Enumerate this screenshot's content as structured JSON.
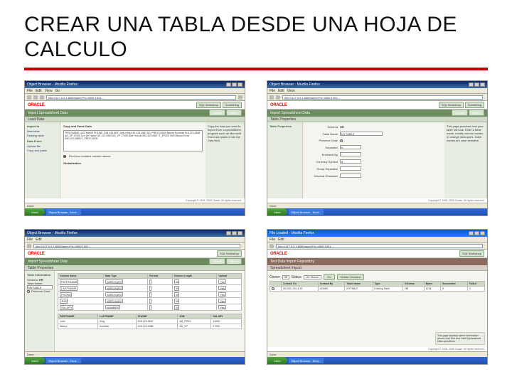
{
  "slide": {
    "title": "CREAR UNA TABLA DESDE UNA HOJA DE CALCULO"
  },
  "common": {
    "window_title": "Object Browser - Mozilla Firefox",
    "menu": {
      "file": "File",
      "edit": "Edit",
      "view": "View",
      "go": "Go"
    },
    "url": "http://127.0.0.1:8080/apex/f?p=4500:1001:...",
    "oracle_logo": "ORACLE",
    "tabs": {
      "sql_workshop": "SQL Workshop",
      "something": "Something"
    },
    "status_done": "Done",
    "start": "Inicio",
    "task": "Object Browser - Mozi..."
  },
  "shot1": {
    "app_title": "Import Spreadsheet Data",
    "sub": "Load Data",
    "side_title1": "Import to",
    "side_item1": "New table",
    "side_item2": "Existing table",
    "side_title2": "Data From:",
    "side_item3": "Upload file",
    "side_item4": "Copy and paste",
    "box_title": "Copy and Paste Data",
    "paste_sample": "FIRSTNAME LASTNAME PHONE JOB SALARY\nJohn King 515.123.4567 AD_PRES 24000\nNeena Kochhar 515.123.4568 AD_VP 17000\nLex De Haan 515.123.4569 AD_VP 17000\nAlex Hunold 590.423.4567 IT_PROG 9000\nBruce Ernst 590.423.4568 IT_PROG 6000",
    "first_row_label": "First row contains column names",
    "globalization": "Globalization",
    "next": "Next >",
    "cancel": "Cancel",
    "hint": "Copy the data you want to import from a spreadsheet program such as Microsoft Excel and paste it into the Data field."
  },
  "shot2": {
    "app_title": "Import Spreadsheet Data",
    "sub": "Table Properties",
    "side_title": "Table Properties",
    "schema_label": "Schema",
    "schema_value": "HR",
    "table_label": "Table Name",
    "table_value": "MYTABLE",
    "preserve_label": "Preserve Case",
    "sep_label": "Separator",
    "sep_value": "\\t",
    "enclosed_label": "Enclosed By",
    "enclosed_value": "\"",
    "curr_label": "Currency Symbol",
    "curr_value": "$",
    "group_label": "Group Separator",
    "group_value": ",",
    "dec_label": "Decimal Character",
    "dec_value": ".",
    "next": "Next >",
    "cancel": "Cancel",
    "hint": "This page previews how your table will look. Enter a table name, modify column names, or change data types. Table names are case sensitive."
  },
  "shot3": {
    "app_title": "Import Spreadsheet Data",
    "sub": "Table Properties",
    "side_title": "Table Information",
    "schema_label": "Schema",
    "schema_value": "HR",
    "table_label": "Table Name",
    "table_value": "MYTABLE",
    "preserve_label": "Preserve Case",
    "next": "Next >",
    "cancel": "Cancel",
    "cols": [
      "Column Name",
      "Data Type",
      "Format",
      "Column Length",
      "Upload"
    ],
    "rows": [
      [
        "FIRSTNAME",
        "VARCHAR2",
        "",
        "30",
        "Yes"
      ],
      [
        "LASTNAME",
        "VARCHAR2",
        "",
        "30",
        "Yes"
      ],
      [
        "PHONE",
        "VARCHAR2",
        "",
        "30",
        "Yes"
      ],
      [
        "JOB",
        "VARCHAR2",
        "",
        "30",
        "Yes"
      ],
      [
        "SALARY",
        "NUMBER",
        "",
        "30",
        "Yes"
      ]
    ],
    "sample_cols": [
      "FIRSTNAME",
      "LASTNAME",
      "PHONE",
      "JOB",
      "SALARY"
    ],
    "sample_rows": [
      [
        "John",
        "King",
        "515.123.4567",
        "AD_PRES",
        "24000"
      ],
      [
        "Neena",
        "Kochhar",
        "515.123.4568",
        "AD_VP",
        "17000"
      ]
    ]
  },
  "shot4": {
    "window_title": "File Loaded - Mozilla Firefox",
    "app_title": "Text Data Import Repository",
    "sub": "Spreadsheet Import",
    "owner_label": "Owner",
    "owner_value": "HR",
    "go": "Go",
    "delete_checked": "Delete Checked",
    "status_label": "Status",
    "status_value": "- All Status -",
    "cols": [
      "",
      "Created On",
      "Created By",
      "Table Name",
      "Type",
      "Schema",
      "Bytes",
      "Succeeded",
      "Failed"
    ],
    "row": [
      "",
      "26-DEC-05 14:30",
      "ADMIN",
      "MYTABLE",
      "Existing Table",
      "HR",
      "1234",
      "5",
      "0"
    ],
    "hint": "This page displays status information about Load Text and Load Spreadsheet Data operations.",
    "copyright": "Copyright © 1999, 2005 Oracle. All rights reserved."
  }
}
